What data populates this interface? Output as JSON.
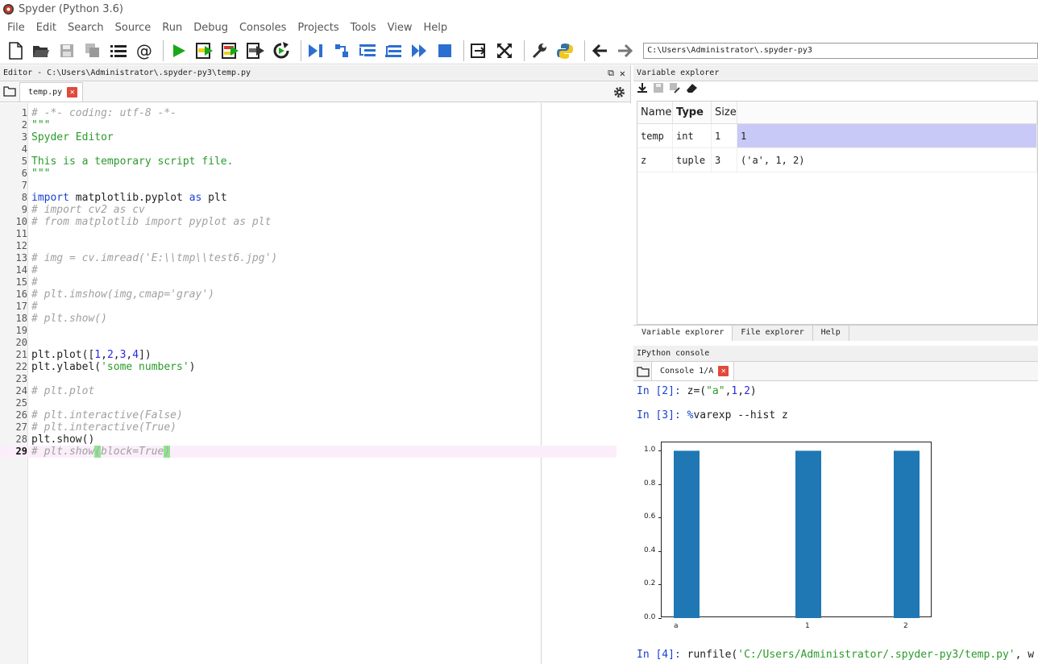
{
  "window": {
    "title": "Spyder (Python 3.6)"
  },
  "menu": [
    "File",
    "Edit",
    "Search",
    "Source",
    "Run",
    "Debug",
    "Consoles",
    "Projects",
    "Tools",
    "View",
    "Help"
  ],
  "toolbar": {
    "path": "C:\\Users\\Administrator\\.spyder-py3"
  },
  "editor": {
    "title": "Editor - C:\\Users\\Administrator\\.spyder-py3\\temp.py",
    "tab": "temp.py",
    "current_line": 29,
    "lines": [
      "# -*- coding: utf-8 -*-",
      "\"\"\"",
      "Spyder Editor",
      "",
      "This is a temporary script file.",
      "\"\"\"",
      "",
      "import matplotlib.pyplot as plt",
      "# import cv2 as cv",
      "# from matplotlib import pyplot as plt",
      "",
      "",
      "# img = cv.imread('E:\\\\tmp\\\\test6.jpg')",
      "#",
      "#",
      "# plt.imshow(img,cmap='gray')",
      "#",
      "# plt.show()",
      "",
      "",
      "plt.plot([1,2,3,4])",
      "plt.ylabel('some numbers')",
      "",
      "# plt.plot",
      "",
      "# plt.interactive(False)",
      "# plt.interactive(True)",
      "plt.show()",
      "# plt.show(block=True)"
    ]
  },
  "variable_explorer": {
    "title": "Variable explorer",
    "headers": [
      "Name",
      "Type",
      "Size",
      ""
    ],
    "rows": [
      {
        "name": "temp",
        "type": "int",
        "size": "1",
        "value": "1"
      },
      {
        "name": "z",
        "type": "tuple",
        "size": "3",
        "value": "('a', 1, 2)"
      }
    ],
    "tabs": [
      "Variable explorer",
      "File explorer",
      "Help"
    ]
  },
  "console": {
    "title": "IPython console",
    "tab": "Console 1/A",
    "lines": [
      {
        "prompt": "In [2]:",
        "code": " z=(\"a\",1,2)"
      },
      {
        "prompt": "In [3]:",
        "code": " %varexp --hist z"
      },
      {
        "prompt": "In [4]:",
        "code": " runfile('C:/Users/Administrator/.spyder-py3/temp.py', w"
      }
    ],
    "chart_data": {
      "type": "bar",
      "categories": [
        "a",
        "1",
        "2"
      ],
      "values": [
        1.0,
        1.0,
        1.0
      ],
      "yticks": [
        "0.0",
        "0.2",
        "0.4",
        "0.6",
        "0.8",
        "1.0"
      ],
      "ylim": [
        0,
        1.05
      ]
    }
  }
}
